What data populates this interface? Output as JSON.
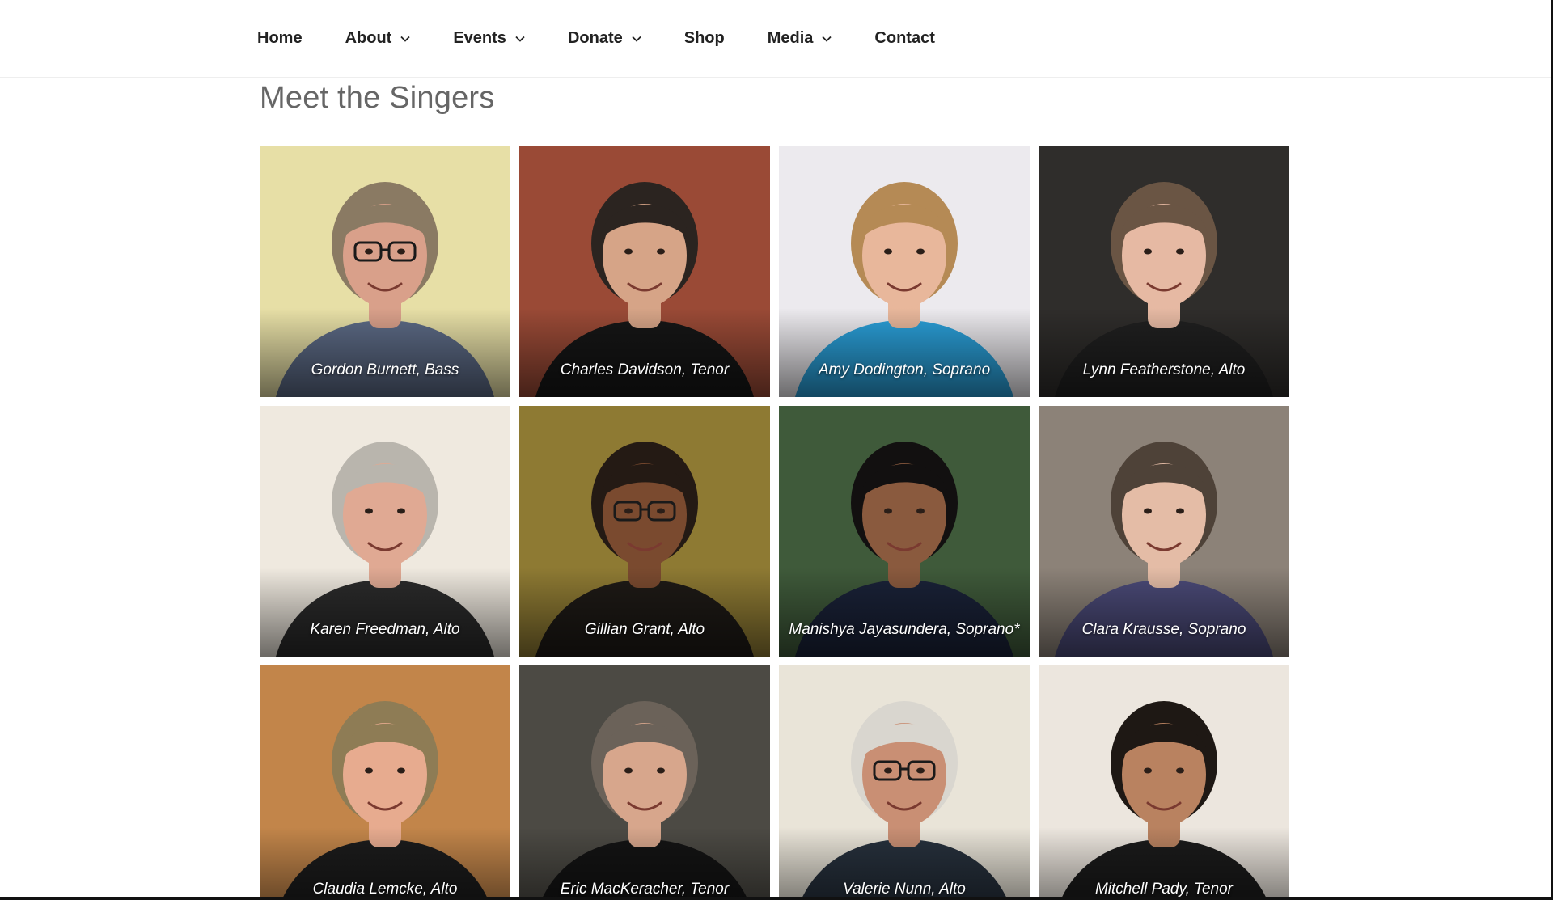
{
  "nav": {
    "items": [
      {
        "label": "Home",
        "has_dropdown": false
      },
      {
        "label": "About",
        "has_dropdown": true
      },
      {
        "label": "Events",
        "has_dropdown": true
      },
      {
        "label": "Donate",
        "has_dropdown": true
      },
      {
        "label": "Shop",
        "has_dropdown": false
      },
      {
        "label": "Media",
        "has_dropdown": true
      },
      {
        "label": "Contact",
        "has_dropdown": false
      }
    ],
    "dropdown_icon": "chevron-down-icon"
  },
  "page": {
    "heading": "Meet the Singers"
  },
  "singers": [
    {
      "caption": "Gordon Burnett, Bass",
      "bg": "#e7dfa6",
      "hair": "#8a7a63",
      "skin": "#d9a08a",
      "shirt": "#5c6a85",
      "glasses": true
    },
    {
      "caption": "Charles Davidson, Tenor",
      "bg": "#9a4a36",
      "hair": "#2b2420",
      "skin": "#d6a487",
      "shirt": "#161616",
      "glasses": false
    },
    {
      "caption": "Amy Dodington, Soprano",
      "bg": "#eceaee",
      "hair": "#b58a55",
      "skin": "#e8b79b",
      "shirt": "#2a9fd8",
      "glasses": false
    },
    {
      "caption": "Lynn Featherstone, Alto",
      "bg": "#2f2d2b",
      "hair": "#6a5544",
      "skin": "#e6b9a3",
      "shirt": "#202020",
      "glasses": false
    },
    {
      "caption": "Karen Freedman, Alto",
      "bg": "#efe9df",
      "hair": "#b9b5ad",
      "skin": "#e0a993",
      "shirt": "#2b2b2b",
      "glasses": false
    },
    {
      "caption": "Gillian Grant, Alto",
      "bg": "#8e7a33",
      "hair": "#241a14",
      "skin": "#7a4a2f",
      "shirt": "#1e1a16",
      "glasses": true
    },
    {
      "caption": "Manishya Jayasundera, Soprano*",
      "bg": "#3f5a3a",
      "hair": "#121010",
      "skin": "#8a5a3e",
      "shirt": "#1a2238",
      "glasses": false
    },
    {
      "caption": "Clara Krausse, Soprano",
      "bg": "#8c8278",
      "hair": "#4e4238",
      "skin": "#e4bca6",
      "shirt": "#4b4a78",
      "glasses": false
    },
    {
      "caption": "Claudia Lemcke, Alto",
      "bg": "#c2854a",
      "hair": "#8e7c55",
      "skin": "#e7ab8f",
      "shirt": "#1c1c1c",
      "glasses": false
    },
    {
      "caption": "Eric MacKeracher, Tenor",
      "bg": "#4c4a44",
      "hair": "#6b6259",
      "skin": "#d7a68c",
      "shirt": "#141414",
      "glasses": false
    },
    {
      "caption": "Valerie Nunn, Alto",
      "bg": "#e9e4d8",
      "hair": "#d9d6cf",
      "skin": "#c98f74",
      "shirt": "#27313d",
      "glasses": true
    },
    {
      "caption": "Mitchell Pady, Tenor",
      "bg": "#ece6de",
      "hair": "#1e1814",
      "skin": "#b98260",
      "shirt": "#1b1b1b",
      "glasses": false
    }
  ]
}
